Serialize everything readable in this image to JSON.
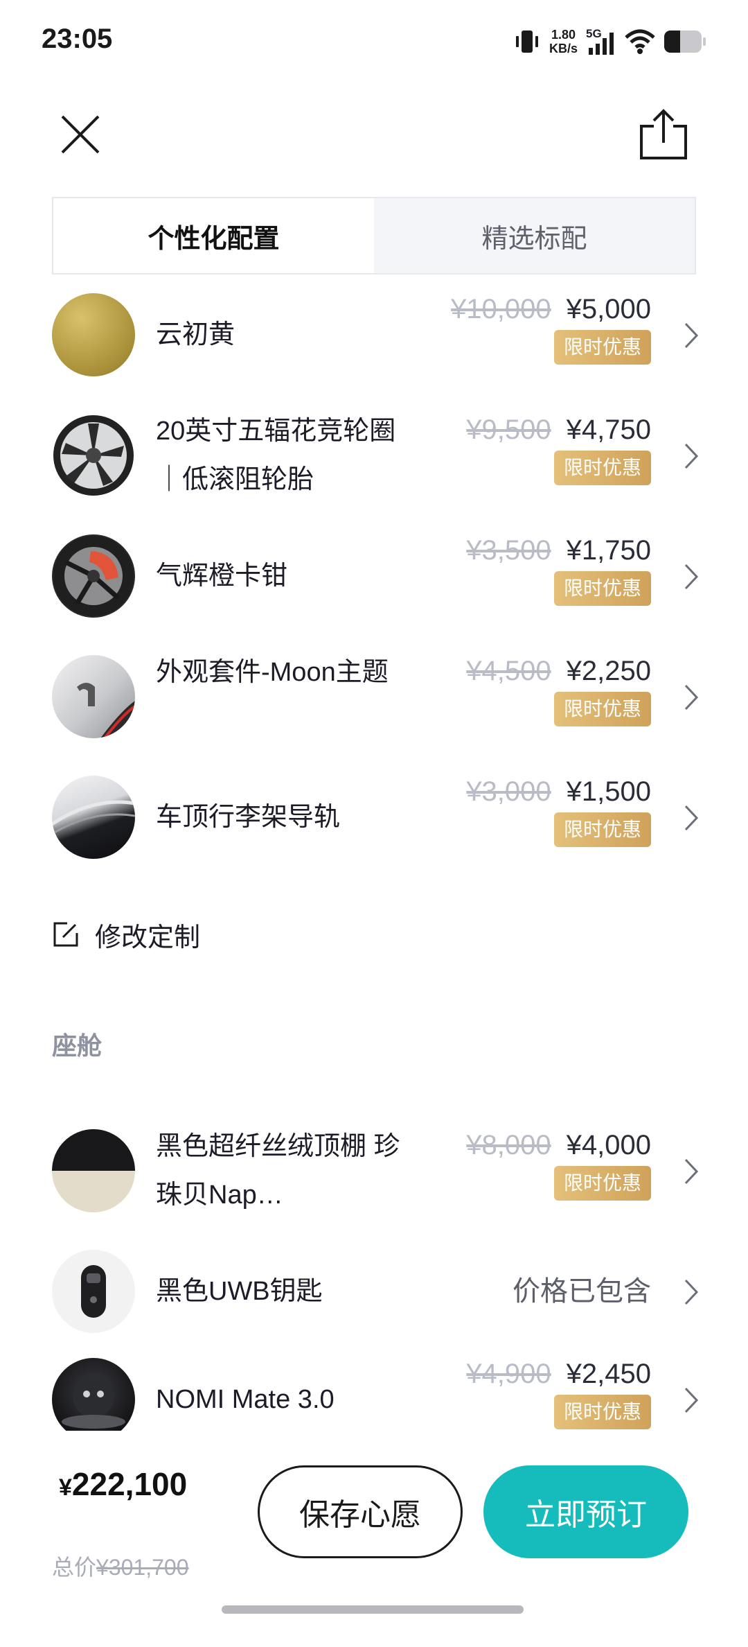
{
  "status_bar": {
    "time": "23:05",
    "speed_value": "1.80",
    "speed_unit": "KB/s",
    "network": "5G"
  },
  "tabs": [
    {
      "label": "个性化配置",
      "active": true
    },
    {
      "label": "精选标配",
      "active": false
    }
  ],
  "exterior_options": [
    {
      "name": "云初黄",
      "old_price": "¥10,000",
      "price": "¥5,000",
      "badge": "限时优惠"
    },
    {
      "name": "20英寸五辐花竞轮圈｜低滚阻轮胎",
      "old_price": "¥9,500",
      "price": "¥4,750",
      "badge": "限时优惠"
    },
    {
      "name": "气辉橙卡钳",
      "old_price": "¥3,500",
      "price": "¥1,750",
      "badge": "限时优惠"
    },
    {
      "name": "外观套件-Moon主题",
      "old_price": "¥4,500",
      "price": "¥2,250",
      "badge": "限时优惠"
    },
    {
      "name": "车顶行李架导轨",
      "old_price": "¥3,000",
      "price": "¥1,500",
      "badge": "限时优惠"
    }
  ],
  "edit_label": "修改定制",
  "section_cabin": "座舱",
  "cabin_options": [
    {
      "name": "黑色超纤丝绒顶棚 珍珠贝Nap…",
      "old_price": "¥8,000",
      "price": "¥4,000",
      "badge": "限时优惠"
    },
    {
      "name": "黑色UWB钥匙",
      "included_text": "价格已包含"
    },
    {
      "name": "NOMI Mate 3.0",
      "old_price": "¥4,900",
      "price": "¥2,450",
      "badge": "限时优惠"
    }
  ],
  "footer": {
    "total_currency": "¥",
    "total_value": "222,100",
    "total_label": "总价",
    "total_original": "¥301,700",
    "save_label": "保存心愿",
    "order_label": "立即预订"
  },
  "colors": {
    "accent": "#16bcbc",
    "badge_gold": "#d9b26a"
  }
}
